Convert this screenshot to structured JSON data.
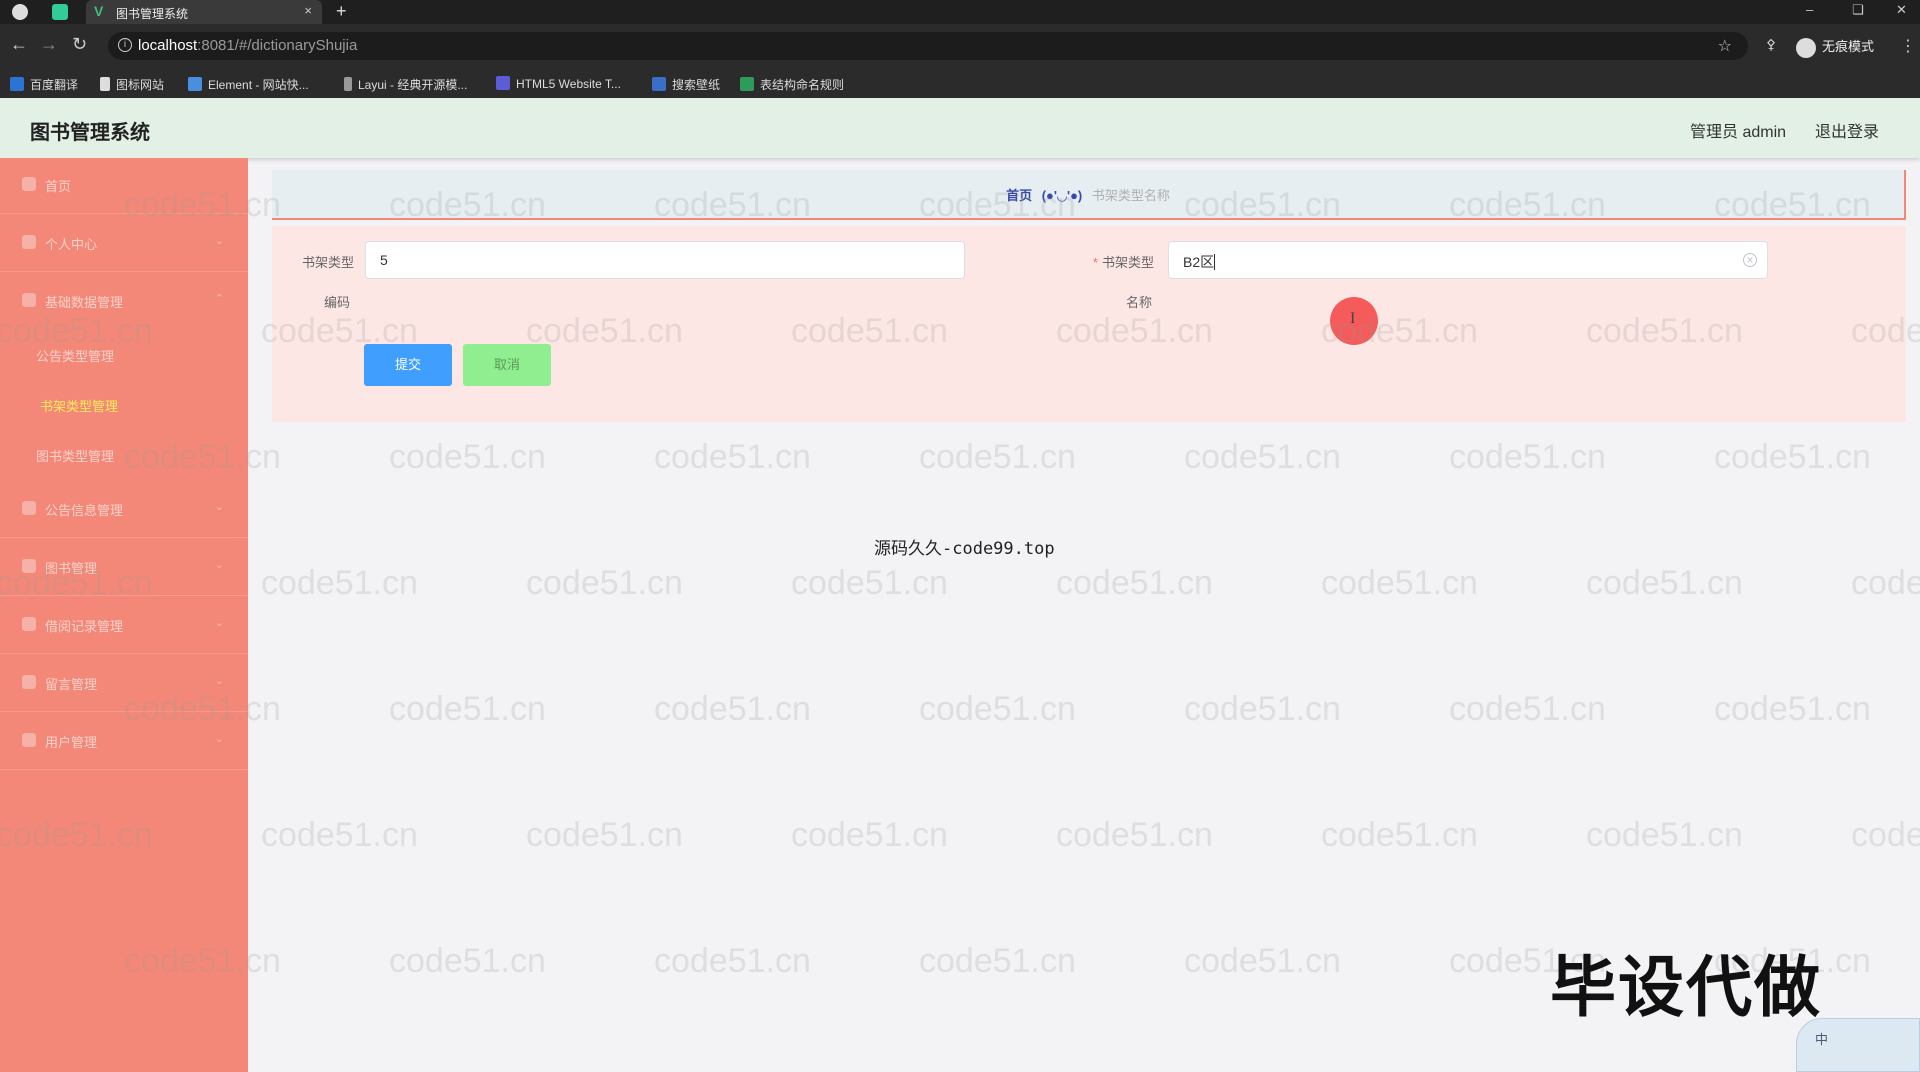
{
  "browser": {
    "tab_title": "图书管理系统",
    "tab_close": "×",
    "new_tab": "+",
    "url_host": "localhost",
    "url_path": ":8081/#/dictionaryShujia",
    "incognito_label": "无痕模式",
    "bookmarks": [
      "百度翻译",
      "图标网站",
      "Element - 网站快...",
      "Layui - 经典开源模...",
      "HTML5 Website T...",
      "搜索壁纸",
      "表结构命名规则"
    ],
    "icons": [
      "back-icon",
      "forward-icon",
      "reload-icon",
      "info-icon",
      "star-icon",
      "key-icon",
      "incognito-icon",
      "menu-icon"
    ]
  },
  "header": {
    "title": "图书管理系统",
    "admin": "管理员 admin",
    "logout": "退出登录"
  },
  "sidebar": {
    "items": [
      {
        "label": "首页",
        "icon": "home-icon"
      },
      {
        "label": "个人中心",
        "icon": "user-icon"
      },
      {
        "label": "基础数据管理",
        "icon": "data-icon"
      },
      {
        "label": "公告信息管理",
        "icon": "location-icon"
      },
      {
        "label": "图书管理",
        "icon": "book-icon"
      },
      {
        "label": "借阅记录管理",
        "icon": "grid-icon"
      },
      {
        "label": "留言管理",
        "icon": "table-icon"
      },
      {
        "label": "用户管理",
        "icon": "users-icon"
      }
    ],
    "subitems": [
      {
        "label": "公告类型管理",
        "active": false
      },
      {
        "label": "书架类型管理",
        "active": true
      },
      {
        "label": "图书类型管理",
        "active": false
      }
    ]
  },
  "breadcrumb": {
    "home": "首页",
    "face": "(●'◡'●)",
    "current": "书架类型名称"
  },
  "form": {
    "code_label_1": "书架类型",
    "code_label_2": "编码",
    "code_value": "5",
    "name_label_1": "书架类型",
    "name_label_2": "名称",
    "name_value": "B2区",
    "required_mark": "*",
    "submit": "提交",
    "cancel": "取消"
  },
  "footer_note": "源码久久-code99.top",
  "watermark_text": "code51.cn",
  "overlay_text": "毕设代做",
  "ime_label": "中",
  "colors": {
    "sidebar": "#f48878",
    "header": "#e3f0e5",
    "submit": "#409eff",
    "cancel": "#90ee90",
    "active_sub": "#ffee58"
  }
}
